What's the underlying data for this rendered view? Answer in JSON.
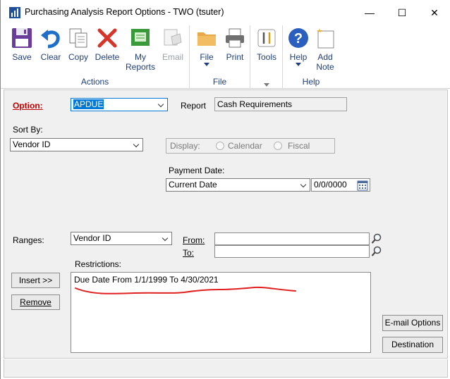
{
  "window": {
    "title": "Purchasing Analysis Report Options  -  TWO (tsuter)",
    "minimize_glyph": "—",
    "maximize_glyph": "☐",
    "close_glyph": "✕"
  },
  "ribbon": {
    "groups": {
      "actions": {
        "label": "Actions",
        "buttons": [
          {
            "label": "Save",
            "icon": "floppy-disk-icon"
          },
          {
            "label": "Clear",
            "icon": "undo-arrow-icon"
          },
          {
            "label": "Copy",
            "icon": "copy-icon"
          },
          {
            "label": "Delete",
            "icon": "delete-x-icon"
          },
          {
            "label": "My",
            "label2": "Reports",
            "icon": "my-reports-icon"
          },
          {
            "label": "Email",
            "icon": "email-icon",
            "disabled": true
          }
        ]
      },
      "file": {
        "label": "File",
        "buttons": [
          {
            "label": "File",
            "icon": "folder-icon",
            "dropdown": true
          },
          {
            "label": "Print",
            "icon": "printer-icon"
          }
        ]
      },
      "tools": {
        "label": "",
        "buttons": [
          {
            "label": "Tools",
            "icon": "tools-icon"
          }
        ]
      },
      "help": {
        "label": "Help",
        "buttons": [
          {
            "label": "Help",
            "icon": "help-icon",
            "dropdown": true
          },
          {
            "label": "Add",
            "label2": "Note",
            "icon": "add-note-icon"
          }
        ]
      }
    }
  },
  "form": {
    "option_label": "Option:",
    "option_value": "APDUE",
    "report_label": "Report",
    "report_value": "Cash Requirements",
    "sort_by_label": "Sort By:",
    "sort_by_value": "Vendor ID",
    "display_label": "Display:",
    "display_calendar": "Calendar",
    "display_fiscal": "Fiscal",
    "payment_date_label": "Payment Date:",
    "payment_date_value": "Current Date",
    "payment_date_date": "0/0/0000",
    "ranges_label": "Ranges:",
    "ranges_value": "Vendor ID",
    "from_label": "From:",
    "from_value": "",
    "to_label": "To:",
    "to_value": "",
    "restrictions_label": "Restrictions:",
    "restrictions": [
      "Due Date From  1/1/1999 To  4/30/2021"
    ],
    "insert_button": "Insert >>",
    "remove_button": "Remove",
    "email_options_button": "E-mail Options",
    "destination_button": "Destination"
  },
  "colors": {
    "accent": "#0078d7",
    "required_label": "#c00000",
    "ribbon_text": "#1f3f7a",
    "annotation": "#e02020"
  }
}
